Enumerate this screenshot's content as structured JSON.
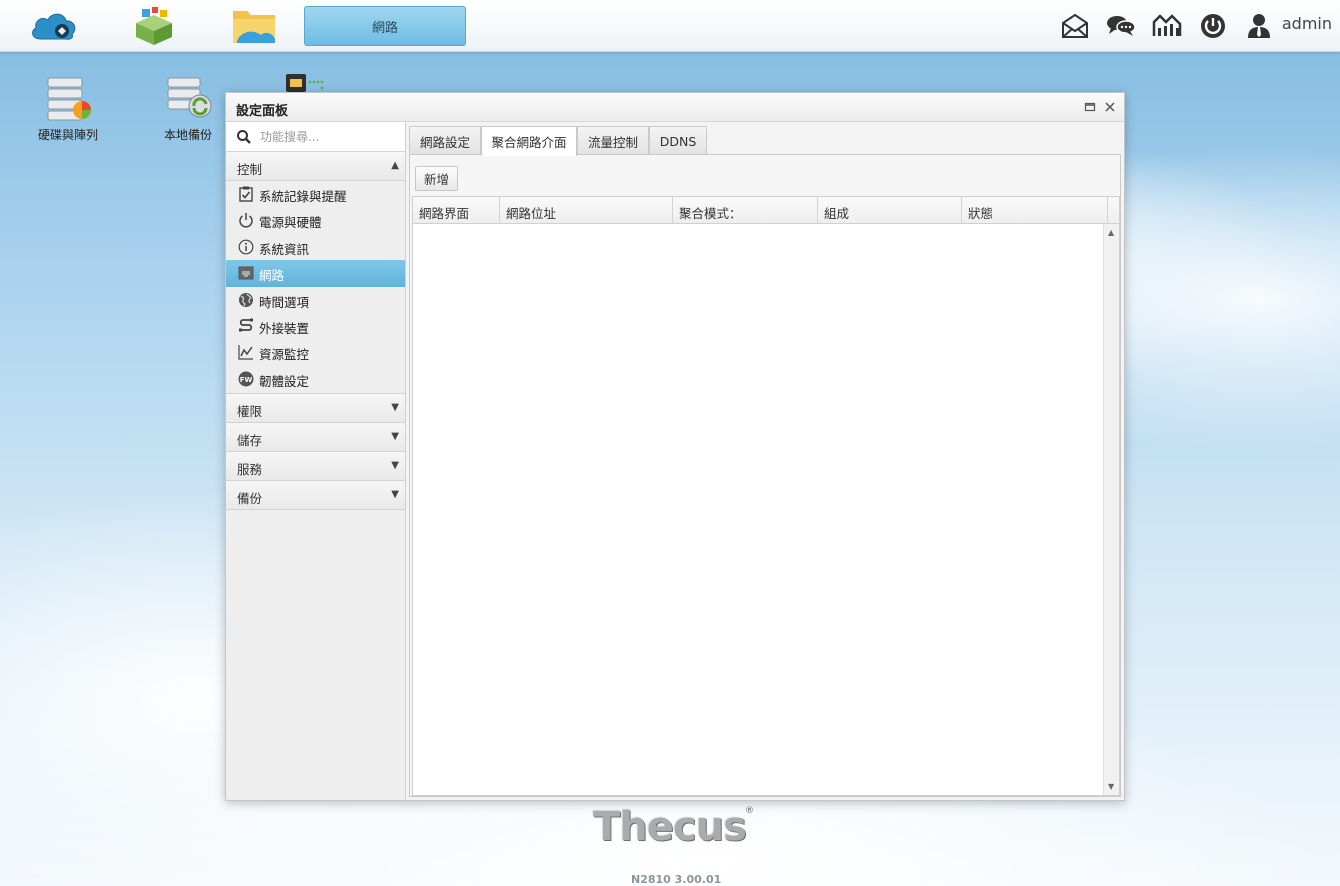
{
  "taskbar": {
    "apps": [
      {
        "name": "cloud-app-icon"
      },
      {
        "name": "app-center-icon"
      },
      {
        "name": "file-manager-icon"
      }
    ],
    "active_window_label": "網路",
    "user": "admin"
  },
  "desktop": {
    "icons": [
      {
        "label": "硬碟與陣列"
      },
      {
        "label": "本地備份"
      }
    ]
  },
  "window": {
    "title": "設定面板",
    "search_placeholder": "功能搜尋...",
    "sections": [
      {
        "label": "控制",
        "expanded": true
      },
      {
        "label": "權限",
        "expanded": false
      },
      {
        "label": "儲存",
        "expanded": false
      },
      {
        "label": "服務",
        "expanded": false
      },
      {
        "label": "備份",
        "expanded": false
      }
    ],
    "control_items": [
      {
        "label": "系統記錄與提醒",
        "icon": "clipboard-check-icon"
      },
      {
        "label": "電源與硬體",
        "icon": "power-icon"
      },
      {
        "label": "系統資訊",
        "icon": "info-icon"
      },
      {
        "label": "網路",
        "icon": "network-port-icon",
        "selected": true
      },
      {
        "label": "時間選項",
        "icon": "globe-icon"
      },
      {
        "label": "外接裝置",
        "icon": "usb-cable-icon"
      },
      {
        "label": "資源監控",
        "icon": "line-chart-icon"
      },
      {
        "label": "韌體設定",
        "icon": "firmware-icon"
      }
    ],
    "tabs": [
      {
        "label": "網路設定"
      },
      {
        "label": "聚合網路介面",
        "active": true
      },
      {
        "label": "流量控制"
      },
      {
        "label": "DDNS"
      }
    ],
    "add_button": "新增",
    "columns": [
      "網路界面",
      "網路位址",
      "聚合模式：",
      "組成",
      "狀態"
    ]
  },
  "footer": {
    "brand": "Thecus",
    "version": "N2810   3.00.01"
  }
}
